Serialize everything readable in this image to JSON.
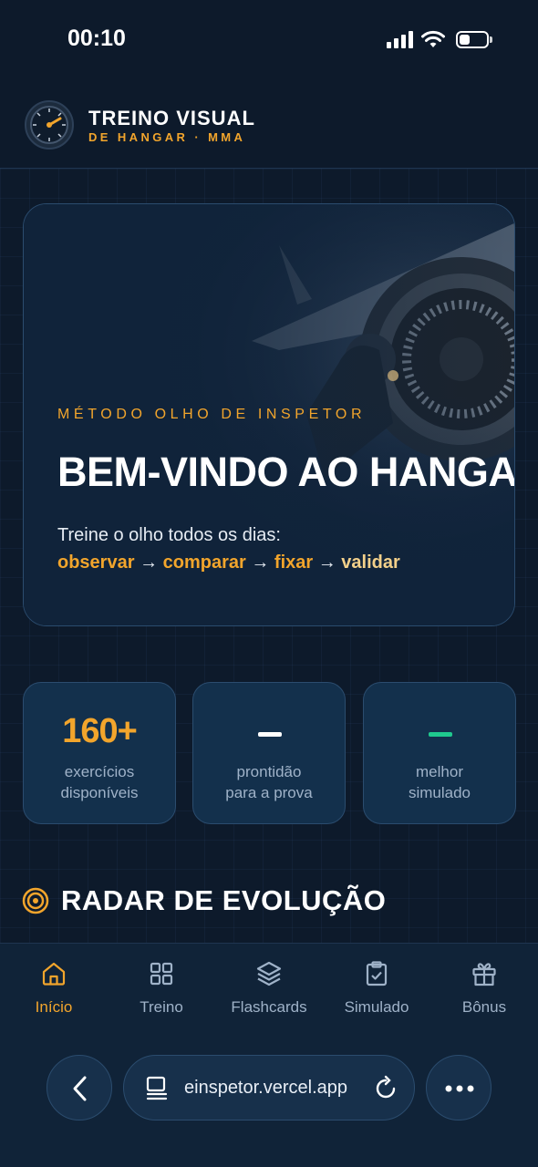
{
  "status_bar": {
    "time": "00:10"
  },
  "header": {
    "title": "TREINO VISUAL",
    "subtitle": "DE HANGAR · MMA",
    "logo_icon": "gauge-icon"
  },
  "hero": {
    "tag": "MÉTODO OLHO DE INSPETOR",
    "title": "BEM-VINDO AO HANGAR.",
    "description": "Treine o olho todos os dias:",
    "steps": [
      "observar",
      "comparar",
      "fixar",
      "validar"
    ],
    "arrow": "→"
  },
  "stats": [
    {
      "value": "160+",
      "label_line1": "exercícios",
      "label_line2": "disponíveis"
    },
    {
      "value": "",
      "label_line1": "prontidão",
      "label_line2": "para a prova",
      "dash_color": "#ffffff"
    },
    {
      "value": "",
      "label_line1": "melhor",
      "label_line2": "simulado",
      "dash_color": "#1fc98e"
    }
  ],
  "section": {
    "title": "RADAR DE EVOLUÇÃO",
    "icon": "target-icon"
  },
  "nav": [
    {
      "label": "Início",
      "icon": "home-icon",
      "active": true
    },
    {
      "label": "Treino",
      "icon": "grid-icon"
    },
    {
      "label": "Flashcards",
      "icon": "layers-icon"
    },
    {
      "label": "Simulado",
      "icon": "clipboard-check-icon"
    },
    {
      "label": "Bônus",
      "icon": "gift-icon"
    }
  ],
  "browser": {
    "url": "einspetor.vercel.app"
  },
  "colors": {
    "accent": "#f2a52c",
    "background": "#0d1a2b",
    "card": "#13304c",
    "success": "#1fc98e"
  }
}
